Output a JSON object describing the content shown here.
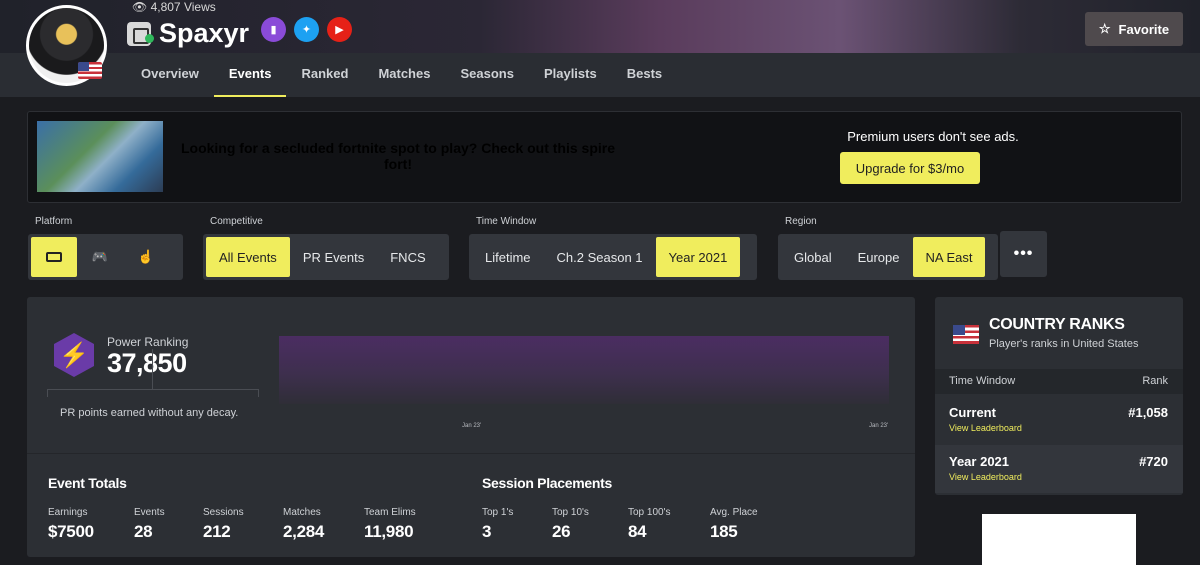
{
  "header": {
    "views": "4,807 Views",
    "player_name": "Spaxyr",
    "socials": [
      "twitch-icon",
      "twitter-icon",
      "youtube-icon"
    ],
    "favorite_label": "Favorite"
  },
  "nav": {
    "tabs": [
      "Overview",
      "Events",
      "Ranked",
      "Matches",
      "Seasons",
      "Playlists",
      "Bests"
    ],
    "active": "Events"
  },
  "ad": {
    "text": "Looking for a secluded fortnite spot to play? Check out this spire fort!",
    "premium_note": "Premium users don't see ads.",
    "upgrade_label": "Upgrade for $3/mo"
  },
  "filters": {
    "platform": {
      "label": "Platform",
      "options": [
        "keyboard-icon",
        "controller-icon",
        "touch-icon"
      ],
      "selected": "keyboard-icon"
    },
    "competitive": {
      "label": "Competitive",
      "options": [
        "All Events",
        "PR Events",
        "FNCS"
      ],
      "selected": "All Events"
    },
    "time_window": {
      "label": "Time Window",
      "options": [
        "Lifetime",
        "Ch.2 Season 1",
        "Year 2021"
      ],
      "selected": "Year 2021"
    },
    "region": {
      "label": "Region",
      "options": [
        "Global",
        "Europe",
        "NA East"
      ],
      "selected": "NA East",
      "more": "•••"
    }
  },
  "power_ranking": {
    "label": "Power Ranking",
    "value": "37,850",
    "note": "PR points earned without any decay.",
    "chart_ticks": [
      "Jan 23'",
      "Jan 23'"
    ]
  },
  "event_totals": {
    "title": "Event Totals",
    "stats": [
      {
        "label": "Earnings",
        "value": "$7500"
      },
      {
        "label": "Events",
        "value": "28"
      },
      {
        "label": "Sessions",
        "value": "212"
      },
      {
        "label": "Matches",
        "value": "2,284"
      },
      {
        "label": "Team Elims",
        "value": "11,980"
      }
    ]
  },
  "session_placements": {
    "title": "Session Placements",
    "stats": [
      {
        "label": "Top 1's",
        "value": "3"
      },
      {
        "label": "Top 10's",
        "value": "26"
      },
      {
        "label": "Top 100's",
        "value": "84"
      },
      {
        "label": "Avg. Place",
        "value": "185"
      }
    ]
  },
  "country_ranks": {
    "title": "COUNTRY RANKS",
    "subtitle": "Player's ranks in United States",
    "col_window": "Time Window",
    "col_rank": "Rank",
    "rows": [
      {
        "name": "Current",
        "link": "View Leaderboard",
        "rank": "#1,058"
      },
      {
        "name": "Year 2021",
        "link": "View Leaderboard",
        "rank": "#720"
      }
    ]
  },
  "colors": {
    "accent": "#f0ed5d",
    "panel": "#2c2f34",
    "background": "#1b1c20",
    "pr_purple": "#6a3ba8"
  }
}
